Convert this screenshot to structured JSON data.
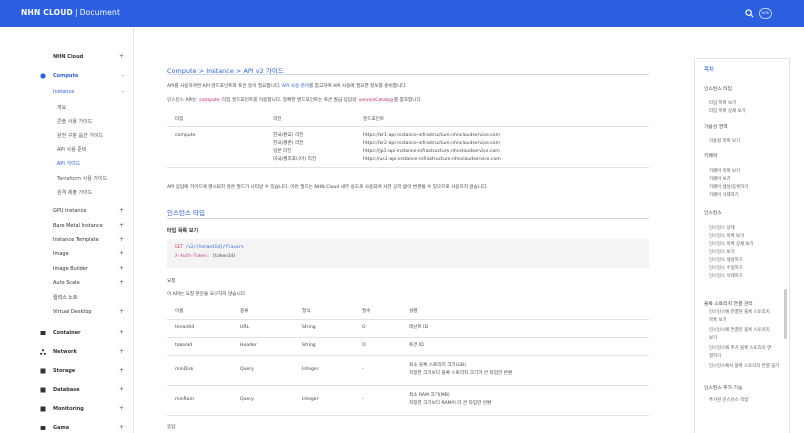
{
  "header": {
    "brand": "NHN CLOUD",
    "separator": "|",
    "section": "Document",
    "lang_label": "KOR",
    "accent": "#2b5fe0"
  },
  "sidebar": {
    "items": [
      {
        "label": "NHN Cloud",
        "toggle": "+",
        "level": 0,
        "icon": ""
      },
      {
        "label": "Compute",
        "toggle": "-",
        "level": 0,
        "icon": "compute-icon",
        "active": true
      },
      {
        "label": "Instance",
        "toggle": "-",
        "level": 1,
        "active": true
      },
      {
        "label": "개요",
        "level": 2
      },
      {
        "label": "콘솔 사용 가이드",
        "level": 2
      },
      {
        "label": "완전 구분 옵션 가이드",
        "level": 2
      },
      {
        "label": "API 사용 준비",
        "level": 2
      },
      {
        "label": "API 가이드",
        "level": 2,
        "active": true
      },
      {
        "label": "Terraform 사용 가이드",
        "level": 2
      },
      {
        "label": "원격 제출 가이드",
        "level": 2
      },
      {
        "label": "GPU Instance",
        "toggle": "+",
        "level": 1
      },
      {
        "label": "Bare Metal Instance",
        "toggle": "+",
        "level": 1
      },
      {
        "label": "Instance Template",
        "toggle": "+",
        "level": 1
      },
      {
        "label": "Image",
        "toggle": "+",
        "level": 1
      },
      {
        "label": "Image Builder",
        "toggle": "+",
        "level": 1
      },
      {
        "label": "Auto Scale",
        "toggle": "+",
        "level": 1
      },
      {
        "label": "릴리스 노트",
        "level": 1
      },
      {
        "label": "Virtual Desktop",
        "toggle": "+",
        "level": 1
      },
      {
        "label": "Container",
        "toggle": "+",
        "level": 0,
        "icon": "container-icon"
      },
      {
        "label": "Network",
        "toggle": "+",
        "level": 0,
        "icon": "network-icon"
      },
      {
        "label": "Storage",
        "toggle": "+",
        "level": 0,
        "icon": "storage-icon"
      },
      {
        "label": "Database",
        "toggle": "+",
        "level": 0,
        "icon": "database-icon"
      },
      {
        "label": "Monitoring",
        "toggle": "+",
        "level": 0,
        "icon": "monitoring-icon"
      },
      {
        "label": "Game",
        "toggle": "+",
        "level": 0,
        "icon": "game-icon"
      }
    ]
  },
  "main": {
    "breadcrumb": "Compute > Instance > API v2 가이드",
    "intro1_pre": "API를 사용하려면 API 엔드포인트와 토큰 등이 필요합니다.",
    "intro1_link": "API 사용 준비",
    "intro1_post": "를 참고하여 API 사용에 필요한 정보를 준비합니다.",
    "intro2_pre": "인스턴스 API는",
    "intro2_code1": "compute",
    "intro2_mid": "타입 엔드포인트를 이용합니다. 정확한 엔드포인트는 토큰 발급 응답의",
    "intro2_code2": "serviceCatalog",
    "intro2_post": "를 참조합니다.",
    "endpoint_table": {
      "headers": [
        "타입",
        "리전",
        "엔드포인트"
      ],
      "type": "compute",
      "regions": [
        "한국(판교) 리전",
        "한국(평촌) 리전",
        "일본 리전",
        "미국(캘리포니아) 리전"
      ],
      "endpoints": [
        "https://kr1-api-instance-infrastructure.nhncloudservice.com",
        "https://kr2-api-instance-infrastructure.nhncloudservice.com",
        "https://jp1-api-instance-infrastructure.nhncloudservice.com",
        "https://us1-api-instance-infrastructure.nhncloudservice.com"
      ]
    },
    "note": "API 응답에 가이드에 명시되지 않은 필드가 나타날 수 있습니다. 이런 필드는 NHN Cloud 내부 용도로 사용되며 사전 공지 없이 변경될 수 있으므로 사용하지 않습니다.",
    "section_title": "인스턴스 타입",
    "sub_title": "타입 목록 보기",
    "code": {
      "line1_method": "GET",
      "line1_path": "/v2/{tenantId}/flavors",
      "line2_key": "X-Auth-Token:",
      "line2_val": "{tokenId}"
    },
    "request_label": "요청",
    "request_desc": "이 API는 요청 본문을 요구하지 않습니다.",
    "param_table": {
      "headers": [
        "이름",
        "종류",
        "형식",
        "필수",
        "설명"
      ],
      "rows": [
        {
          "name": "tenantId",
          "kind": "URL",
          "type": "String",
          "required": "O",
          "desc": [
            "테넌트 ID"
          ]
        },
        {
          "name": "tokenId",
          "kind": "Header",
          "type": "String",
          "required": "O",
          "desc": [
            "토큰 ID"
          ]
        },
        {
          "name": "minDisk",
          "kind": "Query",
          "type": "Integer",
          "required": "-",
          "desc": [
            "최소 블록 스토리지 크기(GB)",
            "지정한 크기보다 블록 스토리지 크기가 큰 타입만 반환"
          ]
        },
        {
          "name": "minRam",
          "kind": "Query",
          "type": "Integer",
          "required": "-",
          "desc": [
            "최소 RAM 크기(MB)",
            "지정한 크기보다 RAM이 더 큰 타입만 반환"
          ]
        }
      ]
    },
    "response_label": "응답"
  },
  "toc": {
    "title": "목차",
    "items": [
      {
        "label": "인스턴스 타입",
        "kind": "h"
      },
      {
        "label": "타입 목록 보기",
        "kind": "s"
      },
      {
        "label": "타입 목록 상세 보기",
        "kind": "s"
      },
      {
        "label": "가용성 영역",
        "kind": "h"
      },
      {
        "label": "가용성 목록 보기",
        "kind": "s"
      },
      {
        "label": "키페어",
        "kind": "h"
      },
      {
        "label": "키페어 목록 보기",
        "kind": "s"
      },
      {
        "label": "키페어 보기",
        "kind": "s"
      },
      {
        "label": "키페어 생성/등록하기",
        "kind": "s"
      },
      {
        "label": "키페어 삭제하기",
        "kind": "s"
      },
      {
        "label": "인스턴스",
        "kind": "h"
      },
      {
        "label": "인스턴스 상태",
        "kind": "s"
      },
      {
        "label": "인스턴스 목록 보기",
        "kind": "s"
      },
      {
        "label": "인스턴스 목록 상세 보기",
        "kind": "s"
      },
      {
        "label": "인스턴스 보기",
        "kind": "s"
      },
      {
        "label": "인스턴스 생성하기",
        "kind": "s"
      },
      {
        "label": "인스턴스 수정하기",
        "kind": "s"
      },
      {
        "label": "인스턴스 삭제하기",
        "kind": "s"
      },
      {
        "label": "블록 스토리지 연결 관리",
        "kind": "h"
      },
      {
        "label": "인스턴스에 연결된 블록 스토리지",
        "kind": "s"
      },
      {
        "label": "목록 보기",
        "kind": "s"
      },
      {
        "label": "인스턴스에 연결된 블록 스토리지",
        "kind": "s"
      },
      {
        "label": "보기",
        "kind": "s"
      },
      {
        "label": "인스턴스에 추가 블록 스토리지 연",
        "kind": "s"
      },
      {
        "label": "결하기",
        "kind": "s"
      },
      {
        "label": "인스턴스에서 블록 스토리지 연결 끊기",
        "kind": "s"
      },
      {
        "label": "인스턴스 추가 기능",
        "kind": "h"
      },
      {
        "label": "추가된 인스턴스 작업",
        "kind": "s"
      }
    ]
  }
}
